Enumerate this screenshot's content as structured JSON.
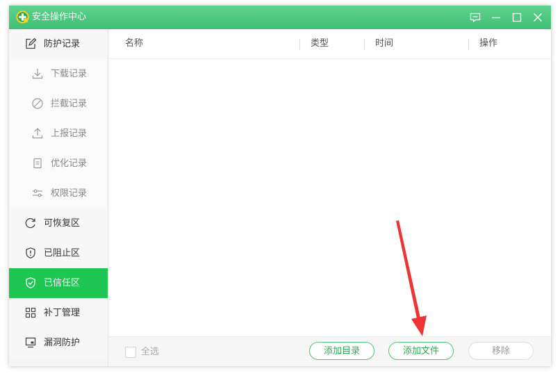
{
  "window": {
    "title": "安全操作中心"
  },
  "titlebar_controls": [
    "feedback-icon",
    "minimize-icon",
    "maximize-icon",
    "close-icon"
  ],
  "sidebar": {
    "items": [
      {
        "label": "防护记录",
        "icon": "edit-icon",
        "kind": "main"
      },
      {
        "label": "下载记录",
        "icon": "download-icon",
        "kind": "sub"
      },
      {
        "label": "拦截记录",
        "icon": "block-icon",
        "kind": "sub"
      },
      {
        "label": "上报记录",
        "icon": "upload-icon",
        "kind": "sub"
      },
      {
        "label": "优化记录",
        "icon": "document-icon",
        "kind": "sub"
      },
      {
        "label": "权限记录",
        "icon": "sliders-icon",
        "kind": "sub"
      },
      {
        "label": "可恢复区",
        "icon": "restore-icon",
        "kind": "main"
      },
      {
        "label": "已阻止区",
        "icon": "shield-alert-icon",
        "kind": "main"
      },
      {
        "label": "已信任区",
        "icon": "shield-check-icon",
        "kind": "main",
        "active": true
      },
      {
        "label": "补丁管理",
        "icon": "grid-icon",
        "kind": "main"
      },
      {
        "label": "漏洞防护",
        "icon": "monitor-icon",
        "kind": "main"
      }
    ]
  },
  "table": {
    "columns": [
      "名称",
      "类型",
      "时间",
      "操作"
    ],
    "rows": []
  },
  "footer": {
    "select_all_label": "全选",
    "add_directory_label": "添加目录",
    "add_file_label": "添加文件",
    "remove_label": "移除"
  },
  "colors": {
    "accent": "#1ec553",
    "titlebar": "#47c47b",
    "annotation_arrow": "#ee3535"
  }
}
